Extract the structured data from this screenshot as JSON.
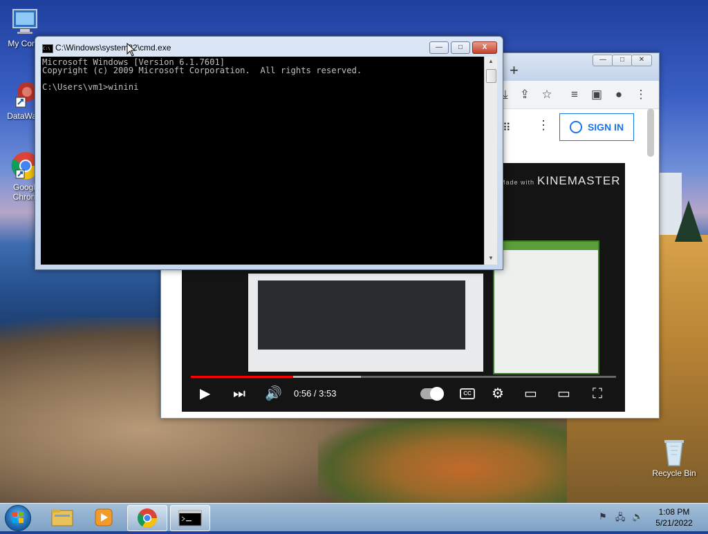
{
  "desktop": {
    "icons": [
      {
        "label": "My Comp"
      },
      {
        "label": "DataWag"
      },
      {
        "label": "Googl Chron"
      },
      {
        "label": "Recycle Bin"
      }
    ]
  },
  "cmd": {
    "title": "C:\\Windows\\system32\\cmd.exe",
    "lines": [
      "Microsoft Windows [Version 6.1.7601]",
      "Copyright (c) 2009 Microsoft Corporation.  All rights reserved.",
      "C:\\Users\\vm1>winini"
    ],
    "minimize": "—",
    "maximize": "□",
    "close": "X"
  },
  "chrome": {
    "signin_label": "SIGN IN",
    "newtab": "+"
  },
  "video": {
    "watermark_prefix": "Made with",
    "watermark": "KINEMASTER",
    "time": "0:56 / 3:53",
    "progress": 0.24,
    "buffered": 0.4,
    "cc_label": "CC"
  },
  "taskbar": {
    "time": "1:08 PM",
    "date": "5/21/2022"
  }
}
